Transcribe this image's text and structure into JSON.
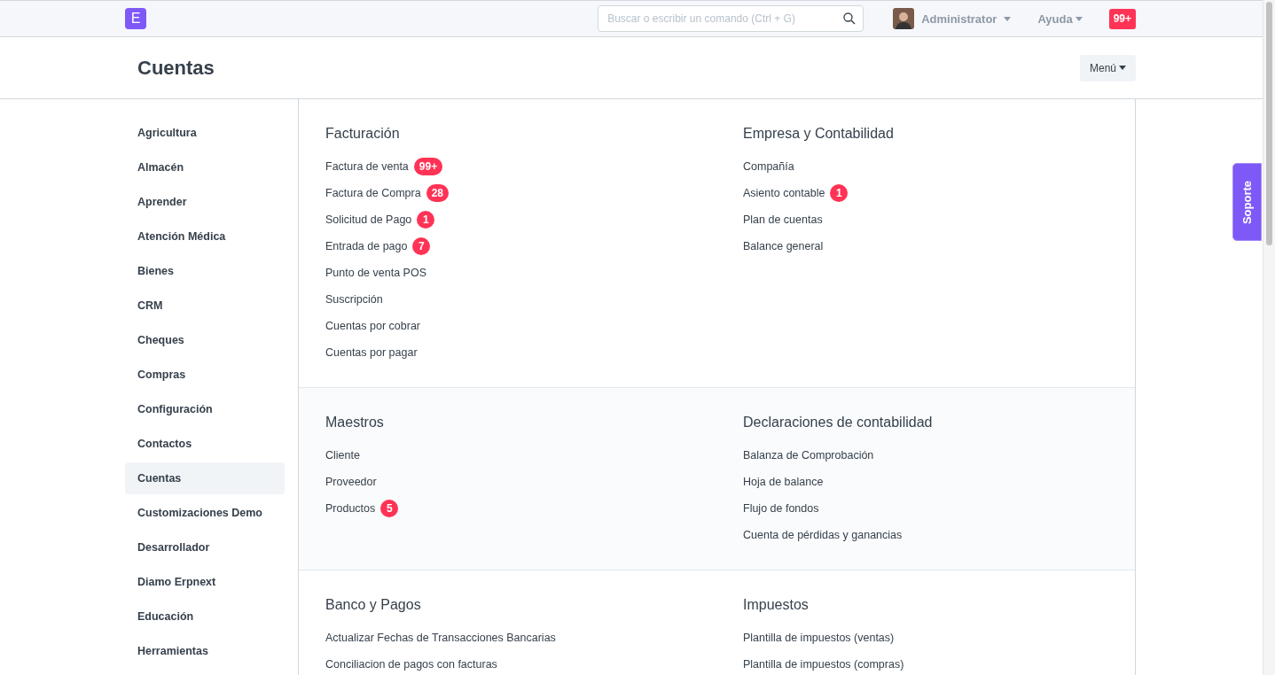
{
  "navbar": {
    "logo": "E",
    "search": {
      "placeholder": "Buscar o escribir un comando (Ctrl + G)"
    },
    "user": {
      "name": "Administrator"
    },
    "help": "Ayuda",
    "notifications": "99+"
  },
  "page_header": {
    "title": "Cuentas",
    "menu_button": "Menú"
  },
  "sidebar": {
    "items": [
      {
        "label": "Agricultura",
        "selected": false
      },
      {
        "label": "Almacén",
        "selected": false
      },
      {
        "label": "Aprender",
        "selected": false
      },
      {
        "label": "Atención Médica",
        "selected": false
      },
      {
        "label": "Bienes",
        "selected": false
      },
      {
        "label": "CRM",
        "selected": false
      },
      {
        "label": "Cheques",
        "selected": false
      },
      {
        "label": "Compras",
        "selected": false
      },
      {
        "label": "Configuración",
        "selected": false
      },
      {
        "label": "Contactos",
        "selected": false
      },
      {
        "label": "Cuentas",
        "selected": true
      },
      {
        "label": "Customizaciones Demo",
        "selected": false
      },
      {
        "label": "Desarrollador",
        "selected": false
      },
      {
        "label": "Diamo Erpnext",
        "selected": false
      },
      {
        "label": "Educación",
        "selected": false
      },
      {
        "label": "Herramientas",
        "selected": false
      }
    ]
  },
  "rows": [
    {
      "columns": [
        {
          "title": "Facturación",
          "links": [
            {
              "label": "Factura de venta",
              "badge": "99+"
            },
            {
              "label": "Factura de Compra",
              "badge": "28"
            },
            {
              "label": "Solicitud de Pago",
              "badge": "1"
            },
            {
              "label": "Entrada de pago",
              "badge": "7"
            },
            {
              "label": "Punto de venta POS"
            },
            {
              "label": "Suscripción"
            },
            {
              "label": "Cuentas por cobrar"
            },
            {
              "label": "Cuentas por pagar"
            }
          ]
        },
        {
          "title": "Empresa y Contabilidad",
          "links": [
            {
              "label": "Compañía"
            },
            {
              "label": "Asiento contable",
              "badge": "1"
            },
            {
              "label": "Plan de cuentas"
            },
            {
              "label": "Balance general"
            }
          ]
        }
      ]
    },
    {
      "columns": [
        {
          "title": "Maestros",
          "links": [
            {
              "label": "Cliente"
            },
            {
              "label": "Proveedor"
            },
            {
              "label": "Productos",
              "badge": "5"
            }
          ]
        },
        {
          "title": "Declaraciones de contabilidad",
          "links": [
            {
              "label": "Balanza de Comprobación"
            },
            {
              "label": "Hoja de balance"
            },
            {
              "label": "Flujo de fondos"
            },
            {
              "label": "Cuenta de pérdidas y ganancias"
            }
          ]
        }
      ]
    },
    {
      "columns": [
        {
          "title": "Banco y Pagos",
          "links": [
            {
              "label": "Actualizar Fechas de Transacciones Bancarias"
            },
            {
              "label": "Conciliacion de pagos con facturas"
            }
          ]
        },
        {
          "title": "Impuestos",
          "links": [
            {
              "label": "Plantilla de impuestos (ventas)"
            },
            {
              "label": "Plantilla de impuestos (compras)"
            }
          ]
        }
      ]
    }
  ],
  "support_tab": "Soporte"
}
